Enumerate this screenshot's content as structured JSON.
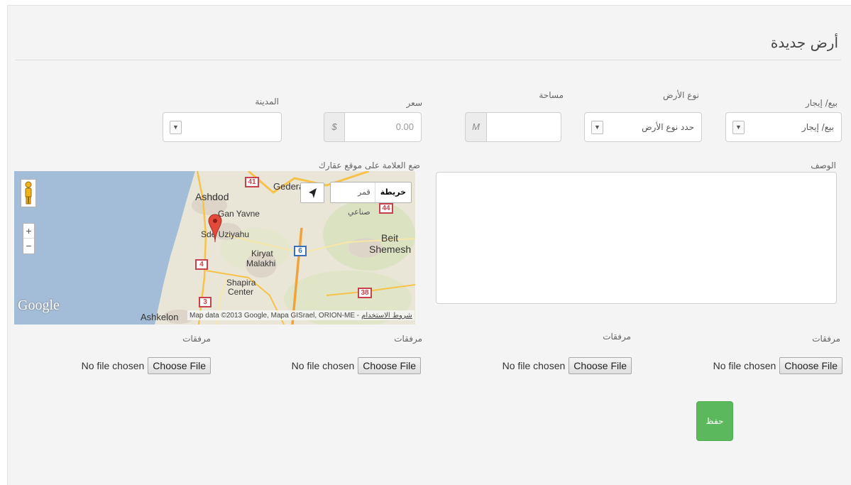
{
  "form": {
    "title": "أرض جديدة",
    "sale_rent": {
      "label": "بيع/ إيجار",
      "value": "بيع/ إيجار"
    },
    "land_type": {
      "label": "نوع الأرض",
      "value": "حدد نوع الأرض"
    },
    "area": {
      "label": "مساحة",
      "unit": "M",
      "value": ""
    },
    "price": {
      "label": "سعر",
      "currency": "$",
      "value": "0.00"
    },
    "city": {
      "label": "المدينة",
      "value": ""
    },
    "description": {
      "label": "الوصف",
      "value": ""
    },
    "map_label": "ضع العلامة على موقع عقارك",
    "attachments": [
      {
        "label": "مرفقات",
        "button": "Choose File",
        "status": "No file chosen"
      },
      {
        "label": "مرفقات",
        "button": "Choose File",
        "status": "No file chosen"
      },
      {
        "label": "مرفقات",
        "button": "Choose File",
        "status": "No file chosen"
      },
      {
        "label": "مرفقات",
        "button": "Choose File",
        "status": "No file chosen"
      }
    ],
    "save_label": "حفظ"
  },
  "map": {
    "type_map": "خريطة",
    "type_satellite": "قمر صناعي",
    "logo": "Google",
    "attribution": "Map data ©2013 Google, Mapa GISrael, ORION-ME -",
    "terms": "شروط الاستخدام",
    "places": {
      "ashdod": "Ashdod",
      "gedera": "Gedera",
      "gan_yavne": "Gan Yavne",
      "sde_uziyahu": "Sde Uziyahu",
      "kiryat_malakhi_1": "Kiryat",
      "kiryat_malakhi_2": "Malakhi",
      "beit_shemesh_1": "Beit",
      "beit_shemesh_2": "Shemesh",
      "shapira_1": "Shapira",
      "shapira_2": "Center",
      "ashkelon": "Ashkelon"
    },
    "road_shields": {
      "r41": "41",
      "r44": "44",
      "r4": "4",
      "r6": "6",
      "r3": "3",
      "r38": "38"
    },
    "zoom_in": "+",
    "zoom_out": "−"
  },
  "colors": {
    "panel_bg": "#f4f4f4",
    "save_button": "#5cb85c",
    "map_sea": "#a3bdd8",
    "map_land": "#e9e6d7",
    "marker": "#e14b3b"
  }
}
